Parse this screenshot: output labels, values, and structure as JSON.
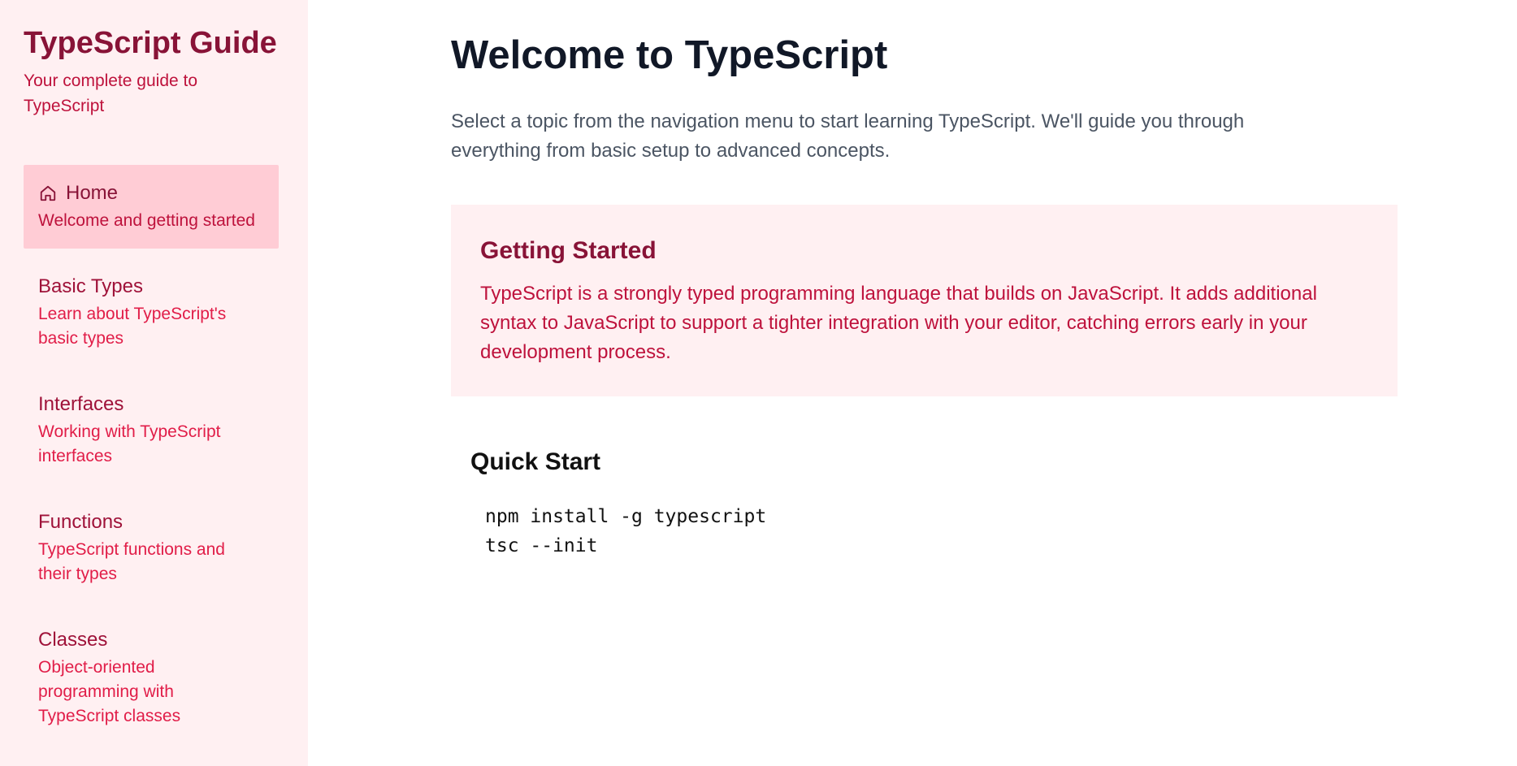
{
  "sidebar": {
    "title": "TypeScript Guide",
    "subtitle": "Your complete guide to TypeScript",
    "items": [
      {
        "label": "Home",
        "description": "Welcome and getting started",
        "active": true,
        "icon": "home-icon"
      },
      {
        "label": "Basic Types",
        "description": "Learn about TypeScript's basic types",
        "active": false
      },
      {
        "label": "Interfaces",
        "description": "Working with TypeScript interfaces",
        "active": false
      },
      {
        "label": "Functions",
        "description": "TypeScript functions and their types",
        "active": false
      },
      {
        "label": "Classes",
        "description": "Object-oriented programming with TypeScript classes",
        "active": false
      }
    ]
  },
  "main": {
    "title": "Welcome to TypeScript",
    "intro": "Select a topic from the navigation menu to start learning TypeScript. We'll guide you through everything from basic setup to advanced concepts.",
    "callout": {
      "title": "Getting Started",
      "text": "TypeScript is a strongly typed programming language that builds on JavaScript. It adds additional syntax to JavaScript to support a tighter integration with your editor, catching errors early in your development process."
    },
    "quick_start": {
      "title": "Quick Start",
      "code_lines": [
        "npm install -g typescript",
        "tsc --init"
      ]
    }
  },
  "colors": {
    "sidebar_bg": "#fff0f2",
    "active_item_bg": "#ffccd5",
    "brand": "#881337",
    "accent": "#be123c",
    "description": "#e11d48"
  }
}
